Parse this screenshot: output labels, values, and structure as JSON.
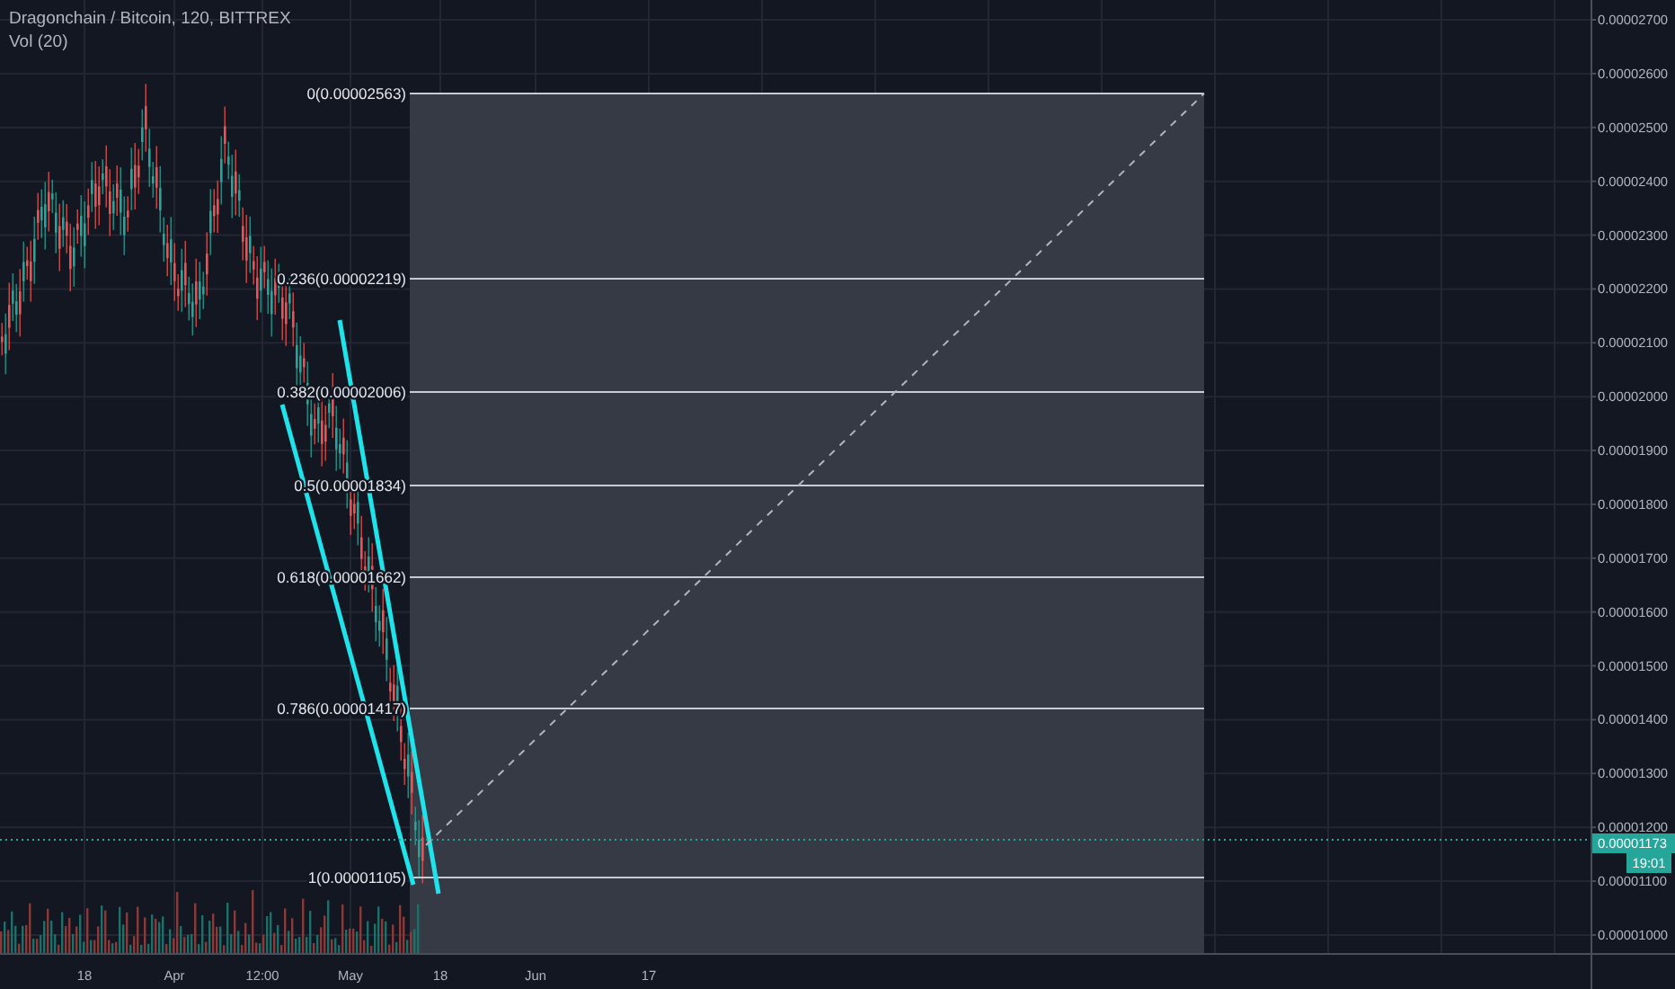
{
  "chart": {
    "title": "Dragonchain / Bitcoin, 120, BITTREX",
    "indicator": "Vol (20)",
    "price_axis": [
      "0.00002700",
      "0.00002600",
      "0.00002500",
      "0.00002400",
      "0.00002300",
      "0.00002200",
      "0.00002100",
      "0.00002000",
      "0.00001900",
      "0.00001800",
      "0.00001700",
      "0.00001600",
      "0.00001500",
      "0.00001400",
      "0.00001300",
      "0.00001200",
      "0.00001100",
      "0.00001000"
    ],
    "current_price": {
      "label": "0.00001173",
      "countdown": "19:01"
    },
    "time_axis": [
      "18",
      "Apr",
      "12:00",
      "May",
      "18",
      "Jun",
      "17"
    ],
    "fib_levels": [
      {
        "label": "0(0.00002563)"
      },
      {
        "label": "0.236(0.00002219)"
      },
      {
        "label": "0.382(0.00002006)"
      },
      {
        "label": "0.5(0.00001834)"
      },
      {
        "label": "0.618(0.00001662)"
      },
      {
        "label": "0.786(0.00001417)"
      },
      {
        "label": "1(0.00001105)"
      }
    ]
  }
}
